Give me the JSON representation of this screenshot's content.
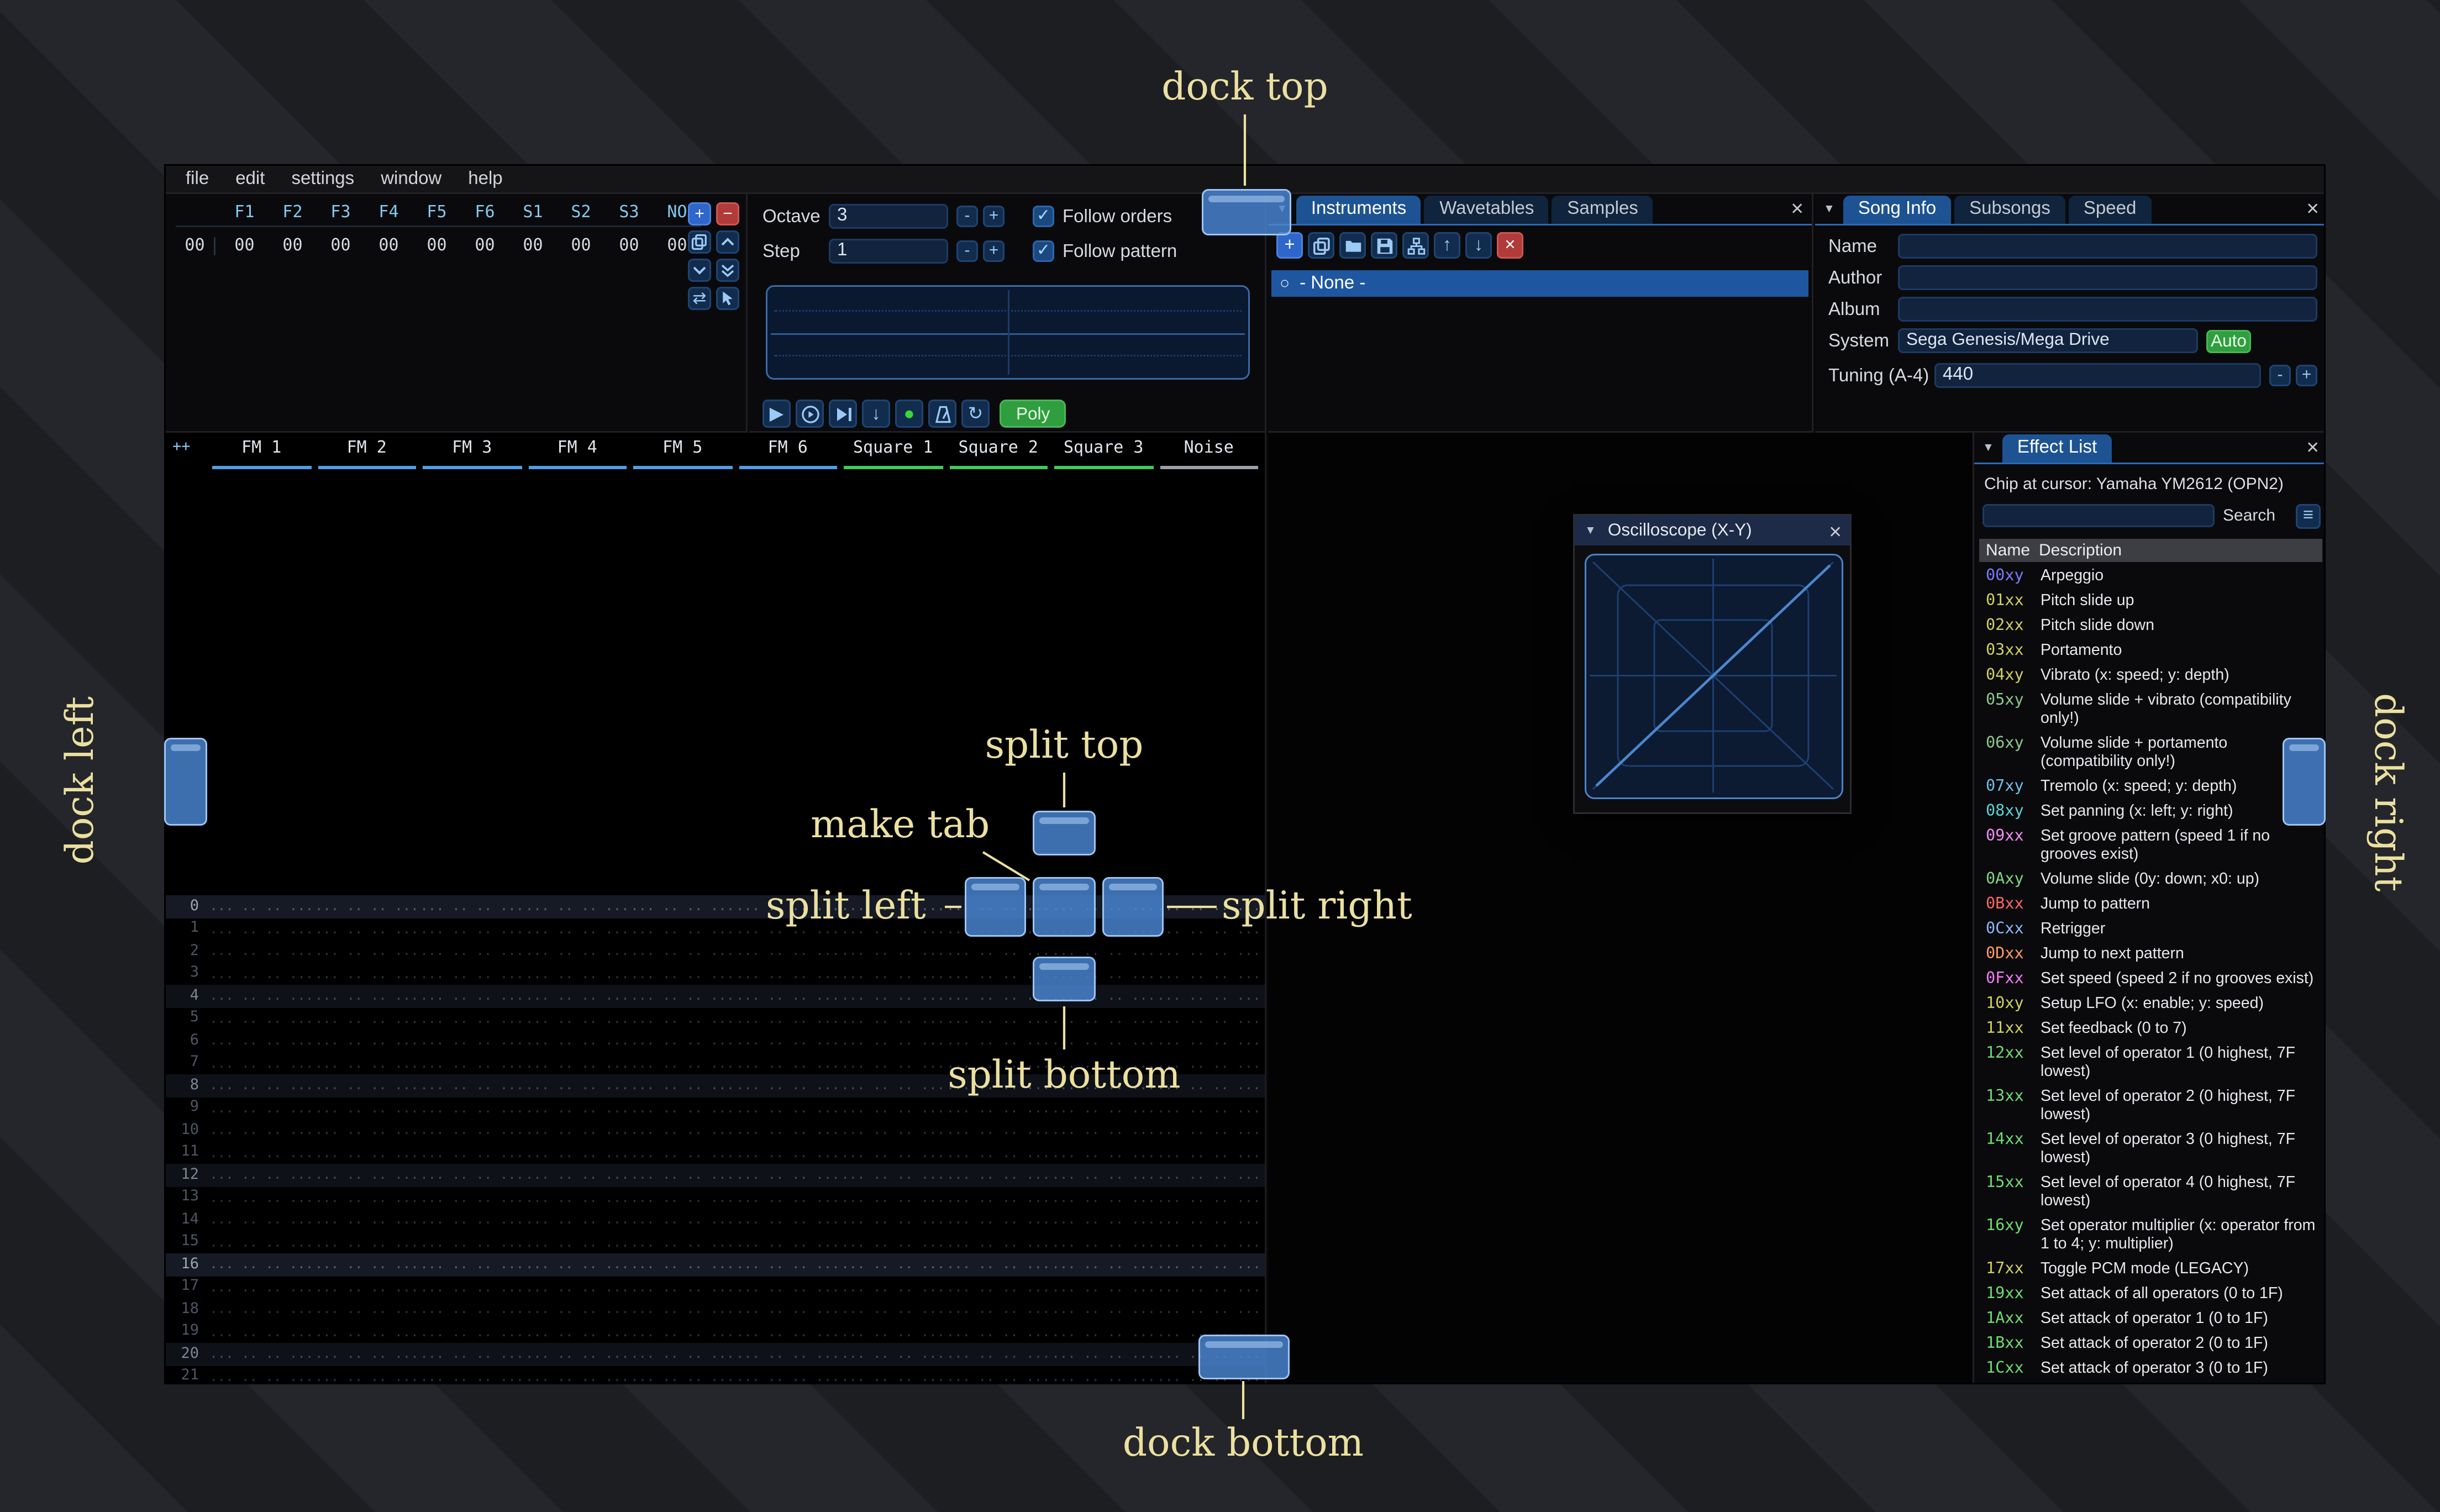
{
  "colors": {
    "accent_blue": "#1d5392",
    "dock_overlay": "#4986d3",
    "annotation_yellow": "#ebe0a0",
    "record_green": "#38d838",
    "auto_green": "#2f9e3f"
  },
  "icons": {
    "close": "×",
    "collapse": "▼",
    "check": "✓",
    "menu_burger": "≡",
    "radio": "○",
    "play": "▶",
    "record": "●",
    "repeat": "↻",
    "arrow_up": "↑",
    "arrow_down": "↓",
    "plus": "+",
    "minus": "−",
    "swap": "⇄",
    "step_down": "↓"
  },
  "annotations": {
    "labels": {
      "dock_top": "dock top",
      "dock_bottom": "dock bottom",
      "dock_left": "dock left",
      "dock_right": "dock right",
      "split_top": "split top",
      "split_bottom": "split bottom",
      "split_left": "split left",
      "split_right": "split right",
      "make_tab": "make tab"
    }
  },
  "menu": {
    "items": [
      "file",
      "edit",
      "settings",
      "window",
      "help"
    ]
  },
  "orders": {
    "index": "00",
    "channels": [
      "F1",
      "F2",
      "F3",
      "F4",
      "F5",
      "F6",
      "S1",
      "S2",
      "S3",
      "NO"
    ],
    "values": [
      "00",
      "00",
      "00",
      "00",
      "00",
      "00",
      "00",
      "00",
      "00",
      "00"
    ]
  },
  "controls": {
    "octave_label": "Octave",
    "octave_value": "3",
    "step_label": "Step",
    "step_value": "1",
    "minus": "-",
    "plus": "+",
    "follow_orders": "Follow orders",
    "follow_pattern": "Follow pattern",
    "poly": "Poly"
  },
  "instruments": {
    "tabs": [
      "Instruments",
      "Wavetables",
      "Samples"
    ],
    "active_tab": "Instruments",
    "items": [
      "- None -"
    ]
  },
  "song_info": {
    "tabs": [
      "Song Info",
      "Subsongs",
      "Speed"
    ],
    "active_tab": "Song Info",
    "name_label": "Name",
    "name_value": "",
    "author_label": "Author",
    "author_value": "",
    "album_label": "Album",
    "album_value": "",
    "system_label": "System",
    "system_value": "Sega Genesis/Mega Drive",
    "auto_button": "Auto",
    "tuning_label": "Tuning (A-4)",
    "tuning_value": "440"
  },
  "pattern": {
    "corner": "++",
    "channels": [
      {
        "name": "FM 1",
        "color": "#4f9ee6"
      },
      {
        "name": "FM 2",
        "color": "#4f9ee6"
      },
      {
        "name": "FM 3",
        "color": "#4f9ee6"
      },
      {
        "name": "FM 4",
        "color": "#4f9ee6"
      },
      {
        "name": "FM 5",
        "color": "#4f9ee6"
      },
      {
        "name": "FM 6",
        "color": "#4f9ee6"
      },
      {
        "name": "Square 1",
        "color": "#3fca59"
      },
      {
        "name": "Square 2",
        "color": "#3fca59"
      },
      {
        "name": "Square 3",
        "color": "#3fca59"
      },
      {
        "name": "Noise",
        "color": "#9aa1a8"
      }
    ],
    "row_numbers": [
      "0",
      "1",
      "2",
      "3",
      "4",
      "5",
      "6",
      "7",
      "8",
      "9",
      "10",
      "11",
      "12",
      "13",
      "14",
      "15",
      "16",
      "17",
      "18",
      "19",
      "20",
      "21"
    ],
    "empty_cell": "... .. .. ..."
  },
  "oscilloscope": {
    "title": "Oscilloscope (X-Y)"
  },
  "effect_list": {
    "title": "Effect List",
    "chip_line": "Chip at cursor: Yamaha YM2612 (OPN2)",
    "search_label": "Search",
    "search_value": "",
    "columns": [
      "Name",
      "Description"
    ],
    "effects": [
      {
        "code": "00xy",
        "color": "#7a7aff",
        "desc": "Arpeggio"
      },
      {
        "code": "01xx",
        "color": "#d0d060",
        "desc": "Pitch slide up"
      },
      {
        "code": "02xx",
        "color": "#d0d060",
        "desc": "Pitch slide down"
      },
      {
        "code": "03xx",
        "color": "#d0d060",
        "desc": "Portamento"
      },
      {
        "code": "04xy",
        "color": "#d0d060",
        "desc": "Vibrato (x: speed; y: depth)"
      },
      {
        "code": "05xy",
        "color": "#8cc98c",
        "desc": "Volume slide + vibrato (compatibility only!)"
      },
      {
        "code": "06xy",
        "color": "#8cc98c",
        "desc": "Volume slide + portamento (compatibility only!)"
      },
      {
        "code": "07xy",
        "color": "#6fc0ea",
        "desc": "Tremolo (x: speed; y: depth)"
      },
      {
        "code": "08xy",
        "color": "#5cd3d3",
        "desc": "Set panning (x: left; y: right)"
      },
      {
        "code": "09xx",
        "color": "#f58cf5",
        "desc": "Set groove pattern (speed 1 if no grooves exist)"
      },
      {
        "code": "0Axy",
        "color": "#7ed67e",
        "desc": "Volume slide (0y: down; x0: up)"
      },
      {
        "code": "0Bxx",
        "color": "#ff6666",
        "desc": "Jump to pattern"
      },
      {
        "code": "0Cxx",
        "color": "#86b9ff",
        "desc": "Retrigger"
      },
      {
        "code": "0Dxx",
        "color": "#ff9966",
        "desc": "Jump to next pattern"
      },
      {
        "code": "0Fxx",
        "color": "#f57af5",
        "desc": "Set speed (speed 2 if no grooves exist)"
      },
      {
        "code": "10xy",
        "color": "#d0d060",
        "desc": "Setup LFO (x: enable; y: speed)"
      },
      {
        "code": "11xx",
        "color": "#d0d060",
        "desc": "Set feedback (0 to 7)"
      },
      {
        "code": "12xx",
        "color": "#6fdc6f",
        "desc": "Set level of operator 1 (0 highest, 7F lowest)"
      },
      {
        "code": "13xx",
        "color": "#6fdc6f",
        "desc": "Set level of operator 2 (0 highest, 7F lowest)"
      },
      {
        "code": "14xx",
        "color": "#6fdc6f",
        "desc": "Set level of operator 3 (0 highest, 7F lowest)"
      },
      {
        "code": "15xx",
        "color": "#6fdc6f",
        "desc": "Set level of operator 4 (0 highest, 7F lowest)"
      },
      {
        "code": "16xy",
        "color": "#6fdc6f",
        "desc": "Set operator multiplier (x: operator from 1 to 4; y: multiplier)"
      },
      {
        "code": "17xx",
        "color": "#d0d060",
        "desc": "Toggle PCM mode (LEGACY)"
      },
      {
        "code": "19xx",
        "color": "#6fdc6f",
        "desc": "Set attack of all operators (0 to 1F)"
      },
      {
        "code": "1Axx",
        "color": "#6fdc6f",
        "desc": "Set attack of operator 1 (0 to 1F)"
      },
      {
        "code": "1Bxx",
        "color": "#6fdc6f",
        "desc": "Set attack of operator 2 (0 to 1F)"
      },
      {
        "code": "1Cxx",
        "color": "#6fdc6f",
        "desc": "Set attack of operator 3 (0 to 1F)"
      }
    ]
  }
}
